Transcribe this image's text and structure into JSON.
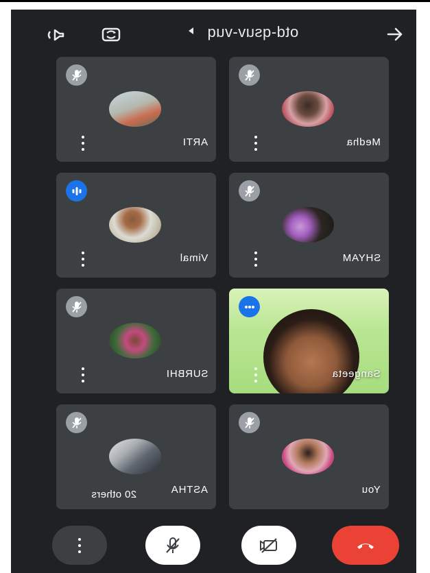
{
  "topbar": {
    "meeting_code": "otd-qsuv-vuq"
  },
  "tiles": [
    {
      "name": "Medha",
      "state": "mic-off"
    },
    {
      "name": "ARTI",
      "state": "mic-off"
    },
    {
      "name": "SHYAM",
      "state": "mic-off"
    },
    {
      "name": "Vimal",
      "state": "speaking"
    },
    {
      "name": "Sangeeta",
      "state": "speaking",
      "video": "on"
    },
    {
      "name": "SURBHI",
      "state": "mic-off"
    },
    {
      "name": "You",
      "state": "mic-off"
    },
    {
      "name": "ASTHA",
      "state": "mic-off"
    }
  ],
  "others_badge": "20 others",
  "controls": {
    "more": "more-options",
    "mic": "mic-off",
    "camera": "camera-off",
    "hangup": "end-call"
  },
  "colors": {
    "background": "#202124",
    "tile": "#3c4043",
    "accent_blue": "#1a73e8",
    "hangup_red": "#ea4335"
  }
}
